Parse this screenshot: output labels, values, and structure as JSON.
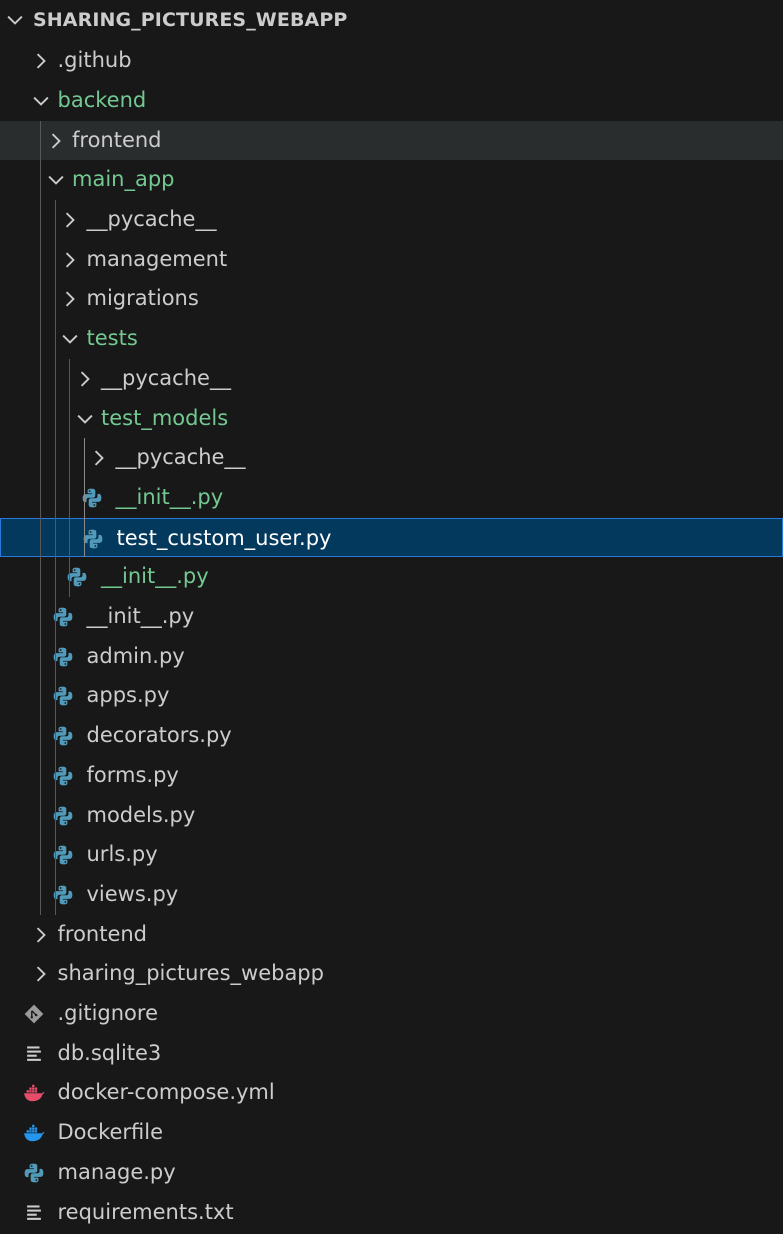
{
  "explorer": {
    "title": "SHARING_PICTURES_WEBAPP",
    "items": [
      {
        "label": ".github",
        "type": "folder",
        "state": "collapsed",
        "depth": 1,
        "color": "default",
        "icon": "chevron-right-icon"
      },
      {
        "label": "backend",
        "type": "folder",
        "state": "expanded",
        "depth": 1,
        "color": "green",
        "icon": "chevron-down-icon"
      },
      {
        "label": "frontend",
        "type": "folder",
        "state": "collapsed",
        "depth": 2,
        "color": "default",
        "icon": "chevron-right-icon",
        "hovered": true
      },
      {
        "label": "main_app",
        "type": "folder",
        "state": "expanded",
        "depth": 2,
        "color": "green",
        "icon": "chevron-down-icon"
      },
      {
        "label": "__pycache__",
        "type": "folder",
        "state": "collapsed",
        "depth": 3,
        "color": "default",
        "icon": "chevron-right-icon"
      },
      {
        "label": "management",
        "type": "folder",
        "state": "collapsed",
        "depth": 3,
        "color": "default",
        "icon": "chevron-right-icon"
      },
      {
        "label": "migrations",
        "type": "folder",
        "state": "collapsed",
        "depth": 3,
        "color": "default",
        "icon": "chevron-right-icon"
      },
      {
        "label": "tests",
        "type": "folder",
        "state": "expanded",
        "depth": 3,
        "color": "green",
        "icon": "chevron-down-icon"
      },
      {
        "label": "__pycache__",
        "type": "folder",
        "state": "collapsed",
        "depth": 4,
        "color": "default",
        "icon": "chevron-right-icon"
      },
      {
        "label": "test_models",
        "type": "folder",
        "state": "expanded",
        "depth": 4,
        "color": "green",
        "icon": "chevron-down-icon"
      },
      {
        "label": "__pycache__",
        "type": "folder",
        "state": "collapsed",
        "depth": 5,
        "color": "default",
        "icon": "chevron-right-icon"
      },
      {
        "label": "__init__.py",
        "type": "file",
        "depth": 5,
        "color": "green",
        "icon": "python-icon"
      },
      {
        "label": "test_custom_user.py",
        "type": "file",
        "depth": 5,
        "color": "default",
        "icon": "python-icon",
        "selected": true
      },
      {
        "label": "__init__.py",
        "type": "file",
        "depth": 4,
        "color": "green",
        "icon": "python-icon"
      },
      {
        "label": "__init__.py",
        "type": "file",
        "depth": 3,
        "color": "default",
        "icon": "python-icon"
      },
      {
        "label": "admin.py",
        "type": "file",
        "depth": 3,
        "color": "default",
        "icon": "python-icon"
      },
      {
        "label": "apps.py",
        "type": "file",
        "depth": 3,
        "color": "default",
        "icon": "python-icon"
      },
      {
        "label": "decorators.py",
        "type": "file",
        "depth": 3,
        "color": "default",
        "icon": "python-icon"
      },
      {
        "label": "forms.py",
        "type": "file",
        "depth": 3,
        "color": "default",
        "icon": "python-icon"
      },
      {
        "label": "models.py",
        "type": "file",
        "depth": 3,
        "color": "default",
        "icon": "python-icon"
      },
      {
        "label": "urls.py",
        "type": "file",
        "depth": 3,
        "color": "default",
        "icon": "python-icon"
      },
      {
        "label": "views.py",
        "type": "file",
        "depth": 3,
        "color": "default",
        "icon": "python-icon"
      },
      {
        "label": "frontend",
        "type": "folder",
        "state": "collapsed",
        "depth": 1,
        "color": "default",
        "icon": "chevron-right-icon"
      },
      {
        "label": "sharing_pictures_webapp",
        "type": "folder",
        "state": "collapsed",
        "depth": 1,
        "color": "default",
        "icon": "chevron-right-icon"
      },
      {
        "label": ".gitignore",
        "type": "file",
        "depth": 1,
        "color": "default",
        "icon": "git-icon"
      },
      {
        "label": "db.sqlite3",
        "type": "file",
        "depth": 1,
        "color": "default",
        "icon": "lines-file-icon"
      },
      {
        "label": "docker-compose.yml",
        "type": "file",
        "depth": 1,
        "color": "default",
        "icon": "docker-compose-icon"
      },
      {
        "label": "Dockerfile",
        "type": "file",
        "depth": 1,
        "color": "default",
        "icon": "docker-icon"
      },
      {
        "label": "manage.py",
        "type": "file",
        "depth": 1,
        "color": "default",
        "icon": "python-icon"
      },
      {
        "label": "requirements.txt",
        "type": "file",
        "depth": 1,
        "color": "default",
        "icon": "lines-file-icon"
      }
    ]
  },
  "colors": {
    "background": "#181818",
    "text": "#cccccc",
    "git_added": "#73c991",
    "selection": "#04395e",
    "selection_border": "#2b79d8",
    "hover": "#2a2d2e",
    "python": "#519aba",
    "docker": "#2496ed",
    "docker_compose": "#e64d6b",
    "git_icon": "#9b9b9b"
  }
}
